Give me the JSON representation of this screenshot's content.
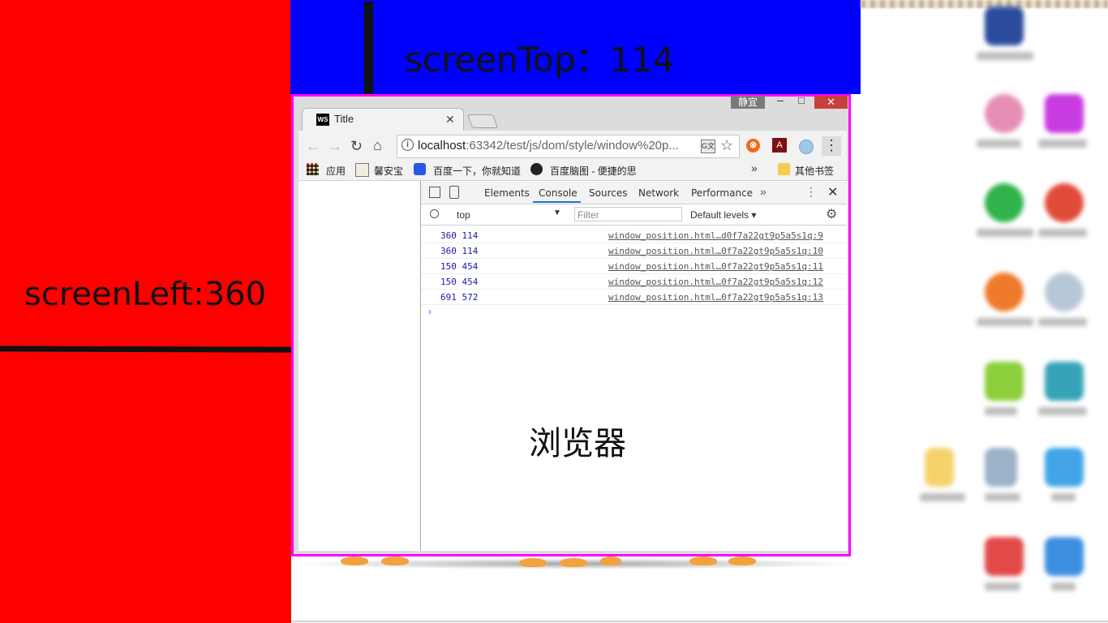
{
  "panels": {
    "screen_left": "screenLeft:360",
    "screen_top": "screenTop：114"
  },
  "browser": {
    "caption_label": "静宜",
    "tab_title": "Title",
    "tab_favicon_text": "WS",
    "url_host": "localhost",
    "url_rest": ":63342/test/js/dom/style/window%20p...",
    "bookmarks": [
      "应用",
      "馨安宝",
      "百度一下，你就知道",
      "百度脑图 - 便捷的思"
    ],
    "other_bookmarks": "其他书签",
    "page_text": "浏览器"
  },
  "devtools": {
    "tabs": [
      "Elements",
      "Console",
      "Sources",
      "Network",
      "Performance"
    ],
    "active_tab": "Console",
    "context": "top",
    "filter_placeholder": "Filter",
    "levels": "Default levels",
    "logs": [
      {
        "msg": "360 114",
        "src": "window_position.html…d0f7a22gt9p5a5s1q:9"
      },
      {
        "msg": "360 114",
        "src": "window_position.html…0f7a22gt9p5a5s1q:10"
      },
      {
        "msg": "150 454",
        "src": "window_position.html…0f7a22gt9p5a5s1q:11"
      },
      {
        "msg": "150 454",
        "src": "window_position.html…0f7a22gt9p5a5s1q:12"
      },
      {
        "msg": "691 572",
        "src": "window_position.html…0f7a22gt9p5a5s1q:13"
      }
    ]
  },
  "colors": {
    "left_panel": "#ff0000",
    "top_panel": "#0000ff",
    "window_border": "#ff00ff"
  }
}
